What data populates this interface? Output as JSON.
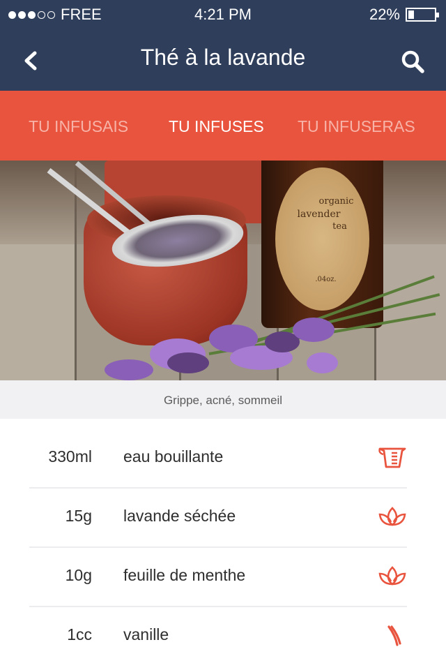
{
  "status": {
    "carrier": "FREE",
    "time": "4:21  PM",
    "battery": "22%",
    "battery_level": 0.22,
    "signal_bars": 3
  },
  "nav": {
    "title": "Thé à la lavande"
  },
  "tabs": [
    {
      "label": "TU INFUSAIS",
      "active": false
    },
    {
      "label": "TU INFUSES",
      "active": true
    },
    {
      "label": "TU INFUSERAS",
      "active": false
    }
  ],
  "hero": {
    "label_lines": [
      "organic",
      "lavender",
      "tea",
      ".04oz."
    ]
  },
  "caption": "Grippe, acné, sommeil",
  "ingredients": [
    {
      "qty": "330ml",
      "name": "eau bouillante",
      "icon": "measuring-cup-icon"
    },
    {
      "qty": "15g",
      "name": "lavande séchée",
      "icon": "lotus-icon"
    },
    {
      "qty": "10g",
      "name": "feuille de menthe",
      "icon": "lotus-icon"
    },
    {
      "qty": "1cc",
      "name": "vanille",
      "icon": "vanilla-pod-icon"
    }
  ],
  "colors": {
    "navbar": "#2f3e5a",
    "tabs": "#e9543f",
    "icon": "#e9543f",
    "caption_bg": "#f1f1f4"
  }
}
